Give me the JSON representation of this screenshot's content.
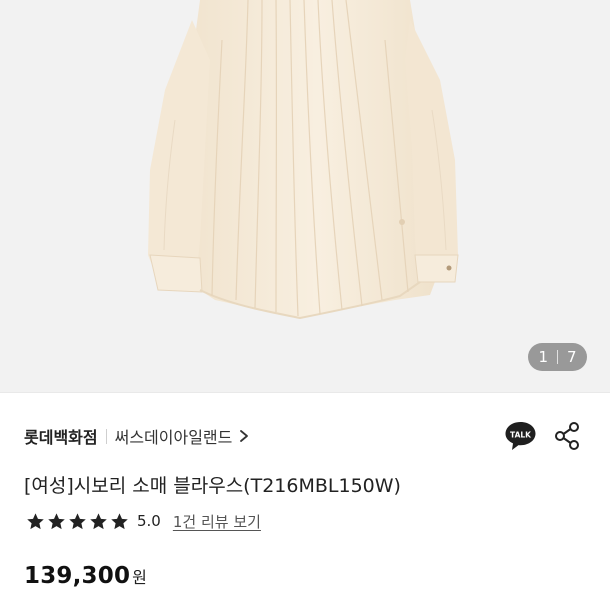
{
  "gallery": {
    "current": "1",
    "total": "7"
  },
  "shop": {
    "brand": "롯데백화점",
    "store": "써스데이아일랜드",
    "talk_label": "TALK"
  },
  "product": {
    "title": "[여성]시보리 소매 블라우스(T216MBL150W)",
    "rating": 5.0,
    "rating_text": "5.0",
    "review_link": "1건 리뷰 보기",
    "price": "139,300",
    "currency": "원"
  },
  "colors": {
    "blouse": "#f6ecdc",
    "background": "#f2f2f2",
    "stars": "#222222"
  }
}
